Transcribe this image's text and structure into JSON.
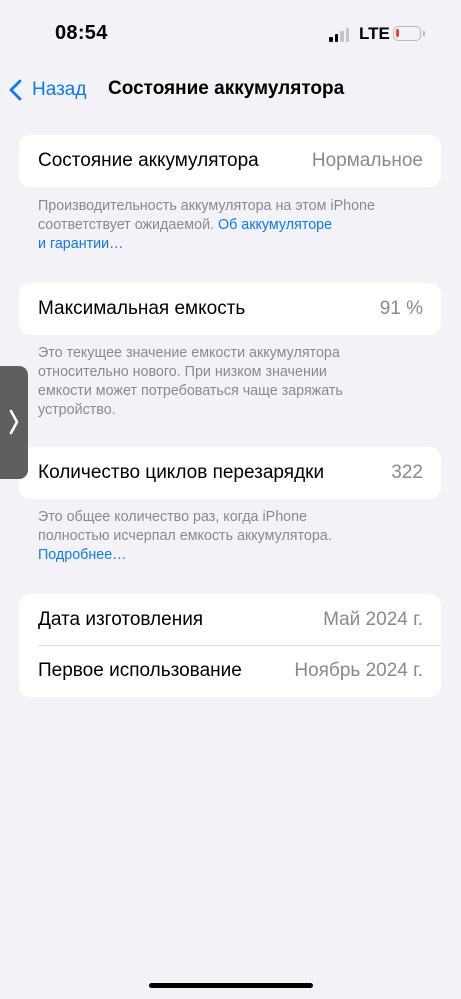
{
  "status_bar": {
    "time": "08:54",
    "network": "LTE",
    "battery_level": 0.15,
    "battery_color": "#ff3b30"
  },
  "nav": {
    "back_label": "Назад",
    "title": "Состояние аккумулятора"
  },
  "battery_health": {
    "label": "Состояние аккумулятора",
    "value": "Нормальное",
    "note_line1": "Производительность аккумулятора на этом iPhone",
    "note_line2_text": "соответствует ожидаемой.",
    "note_link_part1": "Об аккумуляторе",
    "note_link_part2": "и гарантии…"
  },
  "max_capacity": {
    "label": "Максимальная емкость",
    "value": "91 %",
    "note_lines": [
      "Это текущее значение емкости аккумулятора",
      "относительно нового. При низком значении",
      "емкости может потребоваться чаще заряжать",
      "устройство."
    ]
  },
  "cycle_count": {
    "label": "Количество циклов перезарядки",
    "value": "322",
    "note_lines": [
      "Это общее количество раз, когда iPhone",
      "полностью исчерпал емкость аккумулятора."
    ],
    "note_link": "Подробнее…"
  },
  "dates": {
    "manufacture_label": "Дата изготовления",
    "manufacture_value": "Май 2024 г.",
    "first_use_label": "Первое использование",
    "first_use_value": "Ноябрь 2024 г."
  },
  "colors": {
    "accent": "#0a7aff",
    "background": "#f2f2f7",
    "secondary_text": "#8a8a8e"
  }
}
